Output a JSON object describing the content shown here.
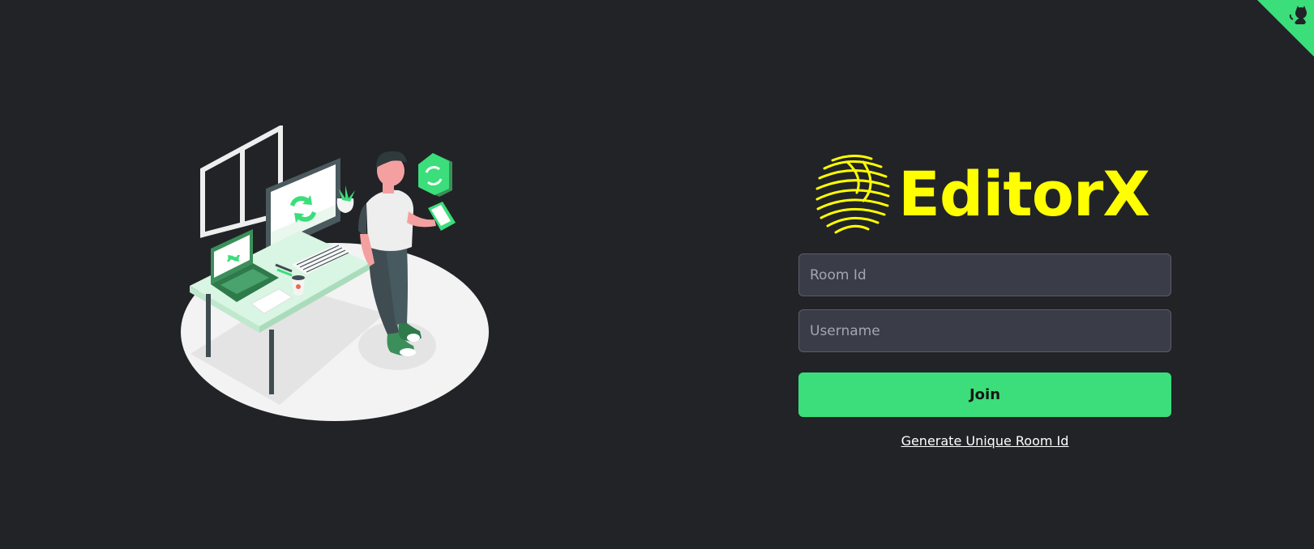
{
  "brand": {
    "name": "EditorX",
    "color": "#ffff00"
  },
  "form": {
    "room_id_placeholder": "Room Id",
    "room_id_value": "",
    "username_placeholder": "Username",
    "username_value": "",
    "join_label": "Join",
    "generate_link_label": "Generate Unique Room Id"
  },
  "colors": {
    "background": "#212327",
    "accent": "#3bde7a",
    "input_bg": "#3a3c48"
  },
  "icons": {
    "corner": "github-corner-icon",
    "logo": "fingerprint-logo-icon"
  }
}
